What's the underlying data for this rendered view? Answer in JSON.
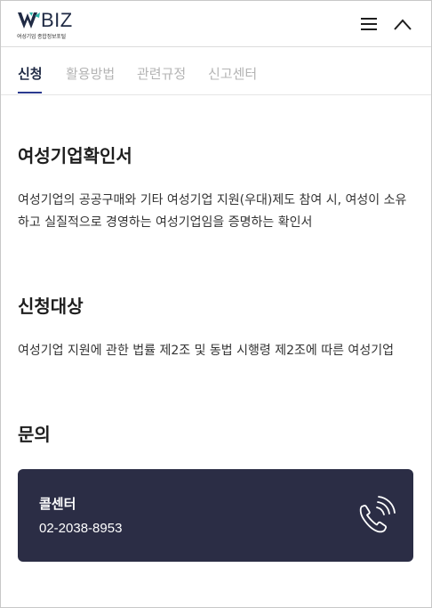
{
  "header": {
    "logo_text": "BIZ",
    "logo_subtitle": "여성기업 종합정보포털",
    "menu_icon": "hamburger-menu-icon",
    "collapse_icon": "chevron-up-icon"
  },
  "tabs": [
    {
      "label": "신청",
      "active": true
    },
    {
      "label": "활용방법",
      "active": false
    },
    {
      "label": "관련규정",
      "active": false
    },
    {
      "label": "신고센터",
      "active": false
    }
  ],
  "sections": {
    "certificate": {
      "title": "여성기업확인서",
      "line1": "여성기업의 공공구매와 기타 여성기업 지원(우대)제도 참여 시, 여성이 소유",
      "line2": "하고 실질적으로 경영하는 여성기업임을 증명하는 확인서"
    },
    "target": {
      "title": "신청대상",
      "body": "여성기업 지원에 관한 법률 제2조 및 동법 시행령 제2조에 따른 여성기업"
    },
    "inquiry": {
      "title": "문의"
    }
  },
  "contact": {
    "title": "콜센터",
    "phone": "02-2038-8953",
    "icon": "phone-ringing-icon"
  },
  "colors": {
    "accent": "#2b3a8f",
    "card_bg": "#2b2d45",
    "tab_inactive": "#b4b4b4"
  }
}
